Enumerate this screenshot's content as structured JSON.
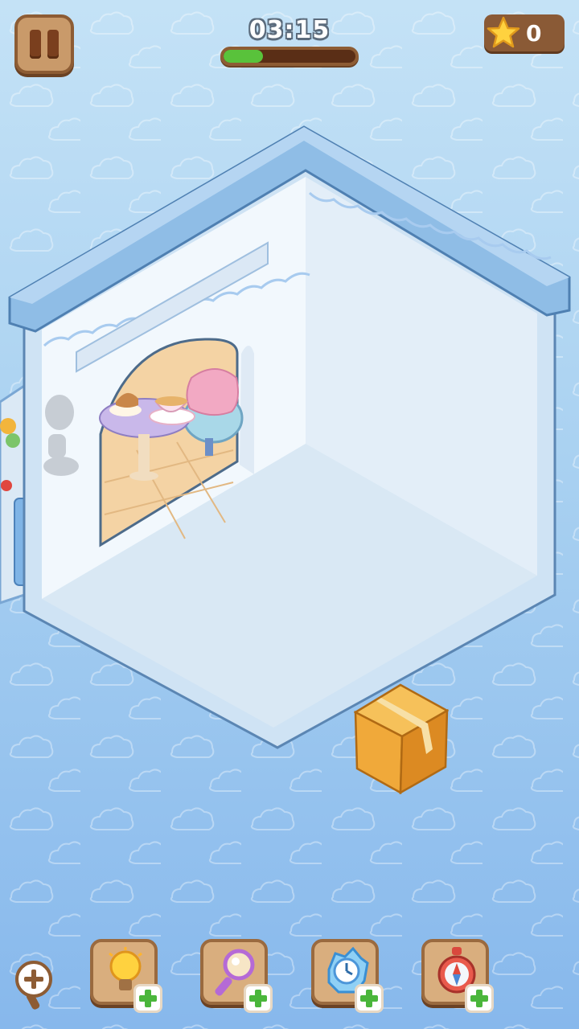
{
  "hud": {
    "timer": "03:15",
    "timer_progress": 0.3,
    "stars": "0",
    "pause_icon": "pause-icon",
    "star_icon": "star-icon"
  },
  "scene": {
    "room_color": "#eaf3fb",
    "wall_trim_color": "#8fbde6",
    "box_color": "#f0a93a"
  },
  "toolbar": {
    "zoom_icon": "zoom-in-magnifier-icon",
    "items": [
      {
        "name": "hint-lightbulb",
        "icon": "lightbulb-icon",
        "badge": "plus"
      },
      {
        "name": "magnifier",
        "icon": "magnifier-icon",
        "badge": "plus"
      },
      {
        "name": "freeze-time",
        "icon": "frozen-clock-icon",
        "badge": "plus"
      },
      {
        "name": "compass",
        "icon": "compass-icon",
        "badge": "plus"
      }
    ]
  }
}
